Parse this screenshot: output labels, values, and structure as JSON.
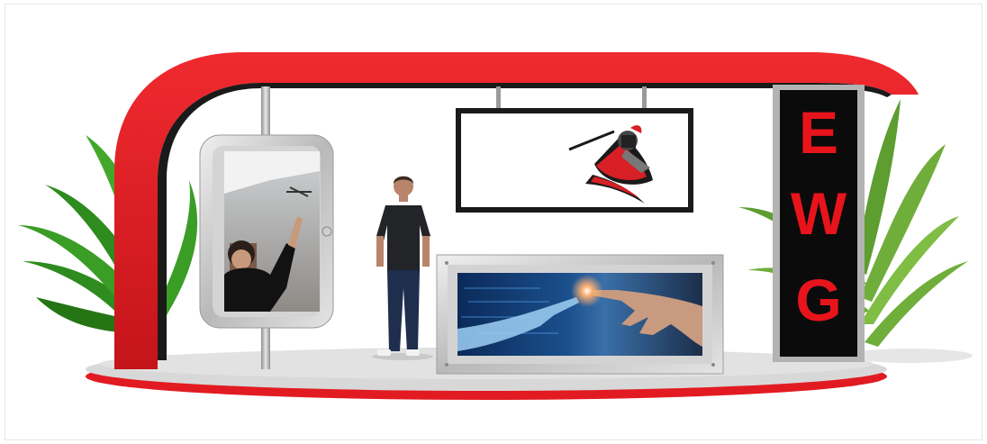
{
  "booth": {
    "tower_letters": [
      "E",
      "W",
      "G"
    ]
  },
  "colors": {
    "canopy": "#e11b22",
    "tower": "#0b0b0b",
    "tower_frame": "#a8a8a8",
    "letters": "#e8141b",
    "floor": "#d9d9d9"
  },
  "icons": {
    "plants": "palm-plant-icon",
    "logo": "knight-mascot-logo",
    "person": "standing-man-figure"
  }
}
